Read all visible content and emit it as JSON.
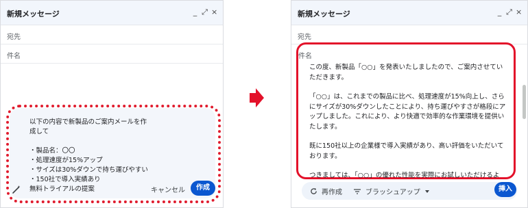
{
  "left": {
    "window_title": "新規メッセージ",
    "window_controls": {
      "minimize": "_",
      "expand": "⤢",
      "close": "×"
    },
    "to_label": "宛先",
    "subject_label": "件名",
    "prompt_lines": [
      "以下の内容で新製品のご案内メールを作",
      "成して",
      "",
      "・製品名：〇〇",
      "・処理速度が15%アップ",
      "・サイズは30%ダウンで持ち運びやすい",
      "・150社で導入実績あり",
      "無料トライアルの提案"
    ],
    "cancel_label": "キャンセル",
    "create_label": "作成",
    "wand_icon": "magic-wand-icon"
  },
  "right": {
    "window_title": "新規メッセージ",
    "window_controls": {
      "minimize": "_",
      "expand": "⤢",
      "close": "×"
    },
    "to_label": "宛先",
    "subject_label": "件名",
    "generated_paragraphs": [
      "この度、新製品「○○」を発表いたしましたので、ご案内させていただきます。",
      "「○○」は、これまでの製品に比べ、処理速度が15%向上し、さらにサイズが30%ダウンしたことにより、持ち運びやすさが格段にアップしました。これにより、より快適で効率的な作業環境を提供いたします。",
      "既に150社以上の企業様で導入実績があり、高い評価をいただいております。",
      "つきましては、「○○」の優れた性能を実際にお試しいただけるよ"
    ],
    "regenerate_label": "再作成",
    "refine_label": "ブラッシュアップ",
    "insert_label": "挿入"
  },
  "colors": {
    "accent_blue": "#0b57d0",
    "highlight_red": "#e3112a",
    "card_bg": "#f3f6fb"
  }
}
